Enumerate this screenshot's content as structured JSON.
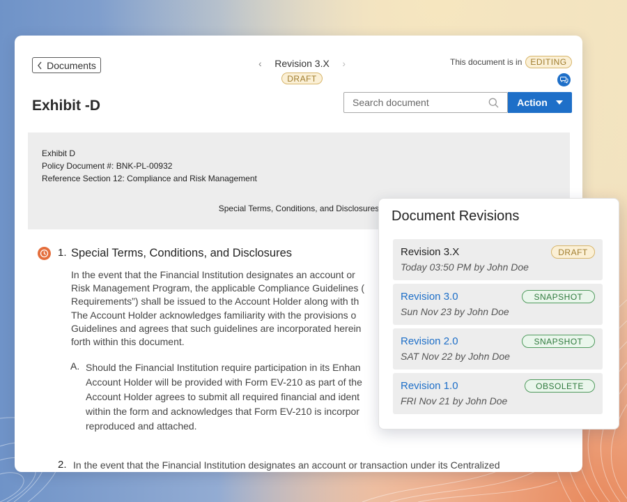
{
  "header": {
    "back_label": "Documents",
    "revision_label": "Revision 3.X",
    "revision_status": "DRAFT",
    "doc_state_text": "This document is in",
    "doc_state": "EDITING",
    "title": "Exhibit -D",
    "search_placeholder": "Search document",
    "action_label": "Action"
  },
  "document": {
    "header_lines": [
      "Exhibit D",
      "Policy Document #: BNK-PL-00932",
      "Reference Section 12: Compliance and Risk Management"
    ],
    "header_center": "Special Terms, Conditions, and Disclosures",
    "section1": {
      "number": "1.",
      "title": "Special Terms, Conditions, and Disclosures",
      "lines": [
        "In the event that the Financial Institution designates an account or",
        "Risk Management Program, the applicable Compliance Guidelines (",
        "Requirements”) shall be issued to the Account Holder along with th",
        "The Account Holder acknowledges familiarity with the provisions o",
        "Guidelines and agrees that such guidelines are incorporated herein",
        "forth within this document."
      ],
      "sub": {
        "letter": "A.",
        "lines": [
          "Should the Financial Institution require participation in its Enhan",
          "Account Holder will be provided with Form EV-210 as part of the",
          "Account Holder agrees to submit all required financial and ident",
          "within the form and acknowledges that Form EV-210 is incorpor",
          "reproduced and attached."
        ]
      }
    },
    "section2": {
      "number": "2.",
      "text": "In the event that the Financial Institution designates an account or transaction under its Centralized"
    }
  },
  "revisions": {
    "title": "Document Revisions",
    "items": [
      {
        "name": "Revision 3.X",
        "meta": "Today 03:50 PM by John Doe",
        "badge": "DRAFT"
      },
      {
        "name": "Revision 3.0",
        "meta": "Sun Nov 23 by John Doe",
        "badge": "SNAPSHOT"
      },
      {
        "name": "Revision 2.0",
        "meta": "SAT Nov 22 by John Doe",
        "badge": "SNAPSHOT"
      },
      {
        "name": "Revision 1.0",
        "meta": "FRI Nov 21 by John Doe",
        "badge": "OBSOLETE"
      }
    ]
  },
  "icons": {
    "back": "chevron-left-icon",
    "prev_revision": "chevron-left-icon",
    "next_revision": "chevron-right-icon",
    "comments": "chat-bubbles-icon",
    "search": "search-icon",
    "action_dropdown": "caret-down-icon",
    "section_marker": "clock-icon"
  },
  "colors": {
    "primary": "#1e6fc8",
    "revision_link": "#1e6fc8",
    "draft_badge": "#a07d2e",
    "snapshot_badge": "#2f7a3d",
    "section_marker": "#e46e3c",
    "document_header_bg": "#ededed"
  }
}
